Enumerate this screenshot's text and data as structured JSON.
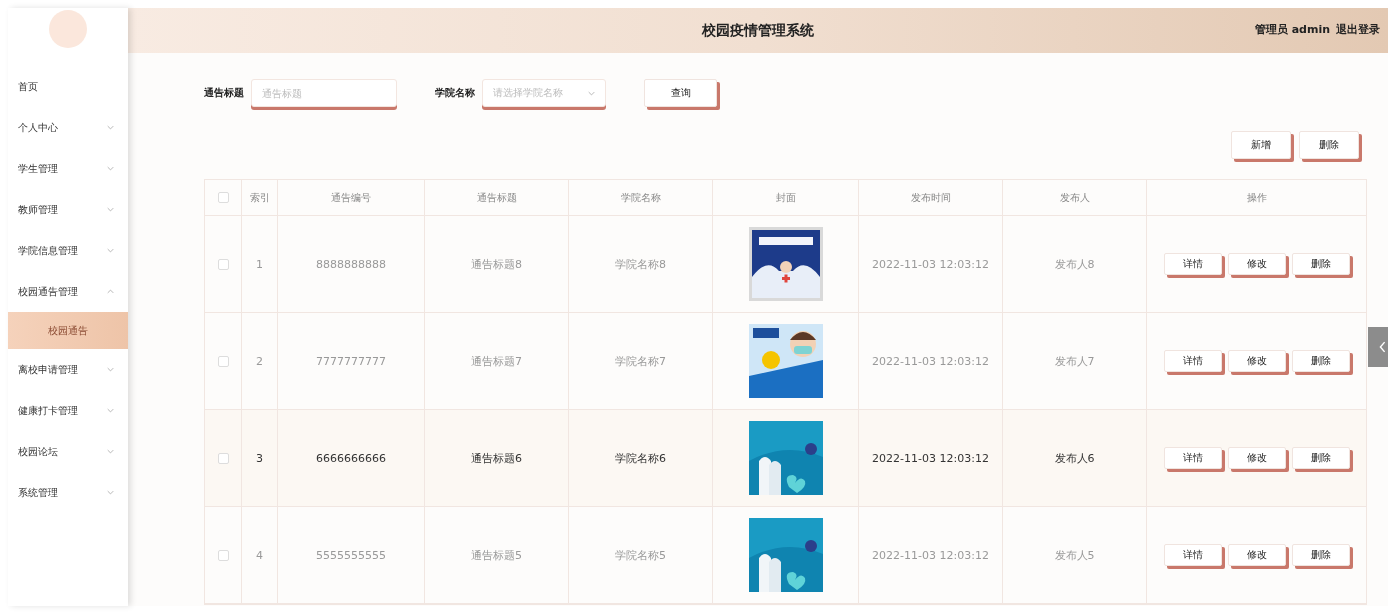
{
  "header": {
    "title": "校园疫情管理系统",
    "user": "管理员 admin",
    "logout": "退出登录"
  },
  "sidebar": {
    "items": [
      {
        "label": "首页",
        "kind": "link"
      },
      {
        "label": "个人中心",
        "kind": "menu",
        "expanded": false
      },
      {
        "label": "学生管理",
        "kind": "menu",
        "expanded": false
      },
      {
        "label": "教师管理",
        "kind": "menu",
        "expanded": false
      },
      {
        "label": "学院信息管理",
        "kind": "menu",
        "expanded": false
      },
      {
        "label": "校园通告管理",
        "kind": "menu",
        "expanded": true,
        "children": [
          {
            "label": "校园通告",
            "selected": true
          }
        ]
      },
      {
        "label": "离校申请管理",
        "kind": "menu",
        "expanded": false
      },
      {
        "label": "健康打卡管理",
        "kind": "menu",
        "expanded": false
      },
      {
        "label": "校园论坛",
        "kind": "menu",
        "expanded": false
      },
      {
        "label": "系统管理",
        "kind": "menu",
        "expanded": false
      }
    ]
  },
  "search": {
    "fields": [
      {
        "label": "通告标题",
        "kind": "text",
        "placeholder": "通告标题"
      },
      {
        "label": "学院名称",
        "kind": "select",
        "placeholder": "请选择学院名称"
      }
    ],
    "button": "查询"
  },
  "actions": [
    "新增",
    "删除"
  ],
  "table": {
    "select_all": {
      "checked": false
    },
    "columns": [
      "索引",
      "通告编号",
      "通告标题",
      "学院名称",
      "封面",
      "发布时间",
      "发布人",
      "操作"
    ],
    "rows": [
      {
        "checked": false,
        "highlighted": false,
        "index": "1",
        "number": "8888888888",
        "title": "通告标题8",
        "college": "学院名称8",
        "cover": {
          "kind": "picture"
        },
        "time": "2022-11-03 12:03:12",
        "publisher": "发布人8",
        "actions": [
          "详情",
          "修改",
          "删除"
        ]
      },
      {
        "checked": false,
        "highlighted": false,
        "index": "2",
        "number": "7777777777",
        "title": "通告标题7",
        "college": "学院名称7",
        "cover": {
          "kind": "picture"
        },
        "time": "2022-11-03 12:03:12",
        "publisher": "发布人7",
        "actions": [
          "详情",
          "修改",
          "删除"
        ]
      },
      {
        "checked": false,
        "highlighted": true,
        "index": "3",
        "number": "6666666666",
        "title": "通告标题6",
        "college": "学院名称6",
        "cover": {
          "kind": "picture"
        },
        "time": "2022-11-03 12:03:12",
        "publisher": "发布人6",
        "actions": [
          "详情",
          "修改",
          "删除"
        ]
      },
      {
        "checked": false,
        "highlighted": false,
        "index": "4",
        "number": "5555555555",
        "title": "通告标题5",
        "college": "学院名称5",
        "cover": {
          "kind": "picture"
        },
        "time": "2022-11-03 12:03:12",
        "publisher": "发布人5",
        "actions": [
          "详情",
          "修改",
          "删除"
        ]
      }
    ]
  }
}
